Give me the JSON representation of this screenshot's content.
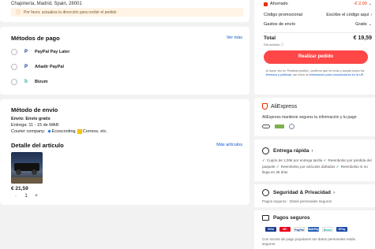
{
  "address": {
    "text": "Chapinería, Madrid, Spain, 28001",
    "warning": "Por favor, actualiza tu dirección para recibir el pedido"
  },
  "payment": {
    "title": "Métodos de pago",
    "more": "Ver más",
    "options": [
      {
        "label": "PayPal Pay Later"
      },
      {
        "label": "Añadir PayPal"
      },
      {
        "label": "Bizum"
      }
    ]
  },
  "shipping": {
    "title": "Método de envío",
    "line1_label": "Envío:",
    "line1_value": "Envío gratis",
    "line2": "Entrega: 11 - 15 de MAR",
    "line3_label": "Courier company:",
    "line3_a": "Ecoscooting",
    "line3_b": "Correos",
    "line3_c": ", etc."
  },
  "item": {
    "title": "Detalle del artículo",
    "more": "Más artículos",
    "price": "€ 21,59",
    "minus": "-",
    "qty": "1",
    "plus": "+"
  },
  "summary": {
    "saved_label": "Ahorrado",
    "saved_value": "-€ 2,00",
    "promo_label": "Código promocional",
    "promo_value": "Escribe el código aquí",
    "ship_label": "Gastos de envío",
    "ship_value": "Gratis",
    "total_label": "Total",
    "total_value": "€ 19,59",
    "vat": "IVA incluido",
    "cta": "Realizar pedido",
    "legal_1": "Al hacer clic en 'Realizar pedido', confirmo que he leído y acepto todos los",
    "legal_link1": "términos y políticas",
    "legal_2": ", así como la",
    "legal_link2": "información para consumidores en la UE",
    "legal_3": "."
  },
  "trust": {
    "brand": "AliExpress",
    "tagline": "AliExpress mantiene seguros tu información y tu pago",
    "fast_title": "Entrega rápida",
    "fast_items": [
      "Cupón de 1,00€ por entrega tardía",
      "Reembolso por pérdida del paquete",
      "Reembolso por artículos dañados",
      "Reembolso si no llega en 35 días"
    ],
    "sec_title": "Seguridad & Privacidad",
    "sec_sub": "Pagos seguros · Datos personales seguros",
    "pay_title": "Pagos seguros",
    "pay_text": "Con socios de pago populares tus datos personales están seguros",
    "logos": [
      "VISA",
      "MC",
      "PayPal",
      "SafePay",
      "Bizum",
      "GPay"
    ],
    "colors": {
      "accent": "#e62e04",
      "button": "#ff4747",
      "link": "#0a58c8",
      "green": "#2f9e44"
    }
  }
}
